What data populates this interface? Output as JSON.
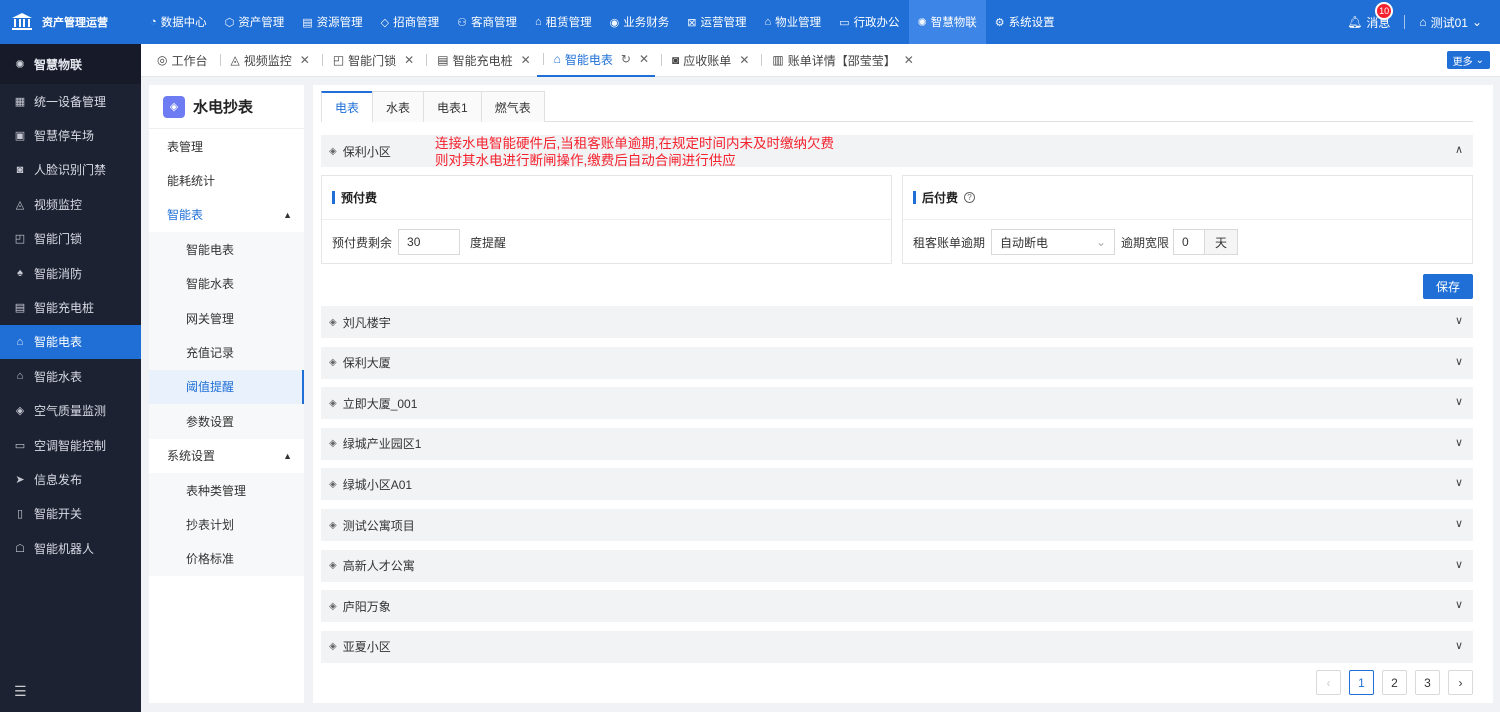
{
  "app": {
    "brand": "资产管理运营"
  },
  "topnav": [
    {
      "icon": "◔",
      "label": "数据中心"
    },
    {
      "icon": "⬡",
      "label": "资产管理"
    },
    {
      "icon": "▤",
      "label": "资源管理"
    },
    {
      "icon": "◇",
      "label": "招商管理"
    },
    {
      "icon": "⚇",
      "label": "客商管理"
    },
    {
      "icon": "⌂",
      "label": "租赁管理"
    },
    {
      "icon": "◉",
      "label": "业务财务"
    },
    {
      "icon": "⊠",
      "label": "运营管理"
    },
    {
      "icon": "⌂",
      "label": "物业管理"
    },
    {
      "icon": "▭",
      "label": "行政办公"
    },
    {
      "icon": "✺",
      "label": "智慧物联"
    },
    {
      "icon": "⚙",
      "label": "系统设置"
    }
  ],
  "top_right": {
    "messages_label": "消息",
    "messages_count": "10",
    "user_label": "测试01"
  },
  "sidebar": {
    "header": "智慧物联",
    "items": [
      {
        "icon": "▦",
        "label": "统一设备管理"
      },
      {
        "icon": "▣",
        "label": "智慧停车场"
      },
      {
        "icon": "◙",
        "label": "人脸识别门禁"
      },
      {
        "icon": "◬",
        "label": "视频监控"
      },
      {
        "icon": "◰",
        "label": "智能门锁"
      },
      {
        "icon": "♠",
        "label": "智能消防"
      },
      {
        "icon": "▤",
        "label": "智能充电桩"
      },
      {
        "icon": "⌂",
        "label": "智能电表"
      },
      {
        "icon": "⌂",
        "label": "智能水表"
      },
      {
        "icon": "◈",
        "label": "空气质量监测"
      },
      {
        "icon": "▭",
        "label": "空调智能控制"
      },
      {
        "icon": "➤",
        "label": "信息发布"
      },
      {
        "icon": "▯",
        "label": "智能开关"
      },
      {
        "icon": "☖",
        "label": "智能机器人"
      }
    ],
    "bottom_icon": "☰"
  },
  "tabs": [
    {
      "icon": "◎",
      "label": "工作台"
    },
    {
      "icon": "◬",
      "label": "视频监控"
    },
    {
      "icon": "◰",
      "label": "智能门锁"
    },
    {
      "icon": "▤",
      "label": "智能充电桩"
    },
    {
      "icon": "⌂",
      "label": "智能电表"
    },
    {
      "icon": "◙",
      "label": "应收账单"
    },
    {
      "icon": "▥",
      "label": "账单详情【邵莹莹】"
    }
  ],
  "more_label": "更多",
  "submenu": {
    "title": "水电抄表",
    "items": [
      {
        "label": "表管理"
      },
      {
        "label": "能耗统计"
      },
      {
        "label": "智能表"
      },
      {
        "label": "智能电表"
      },
      {
        "label": "智能水表"
      },
      {
        "label": "网关管理"
      },
      {
        "label": "充值记录"
      },
      {
        "label": "阈值提醒"
      },
      {
        "label": "参数设置"
      },
      {
        "label": "系统设置"
      },
      {
        "label": "表种类管理"
      },
      {
        "label": "抄表计划"
      },
      {
        "label": "价格标准"
      }
    ]
  },
  "inner_tabs": [
    "电表",
    "水表",
    "电表1",
    "燃气表"
  ],
  "note": {
    "line1": "连接水电智能硬件后,当租客账单逾期,在规定时间内未及时缴纳欠费",
    "line2": "则对其水电进行断闸操作,缴费后自动合闸进行供应"
  },
  "expanded_project": "保利小区",
  "prepaid": {
    "title": "预付费",
    "label": "预付费剩余",
    "value": "30",
    "suffix": "度提醒"
  },
  "postpaid": {
    "title": "后付费",
    "overdue_label": "租客账单逾期",
    "overdue_action": "自动断电",
    "grace_label": "逾期宽限",
    "grace_value": "0",
    "grace_unit": "天"
  },
  "save_label": "保存",
  "projects": [
    "刘凡楼宇",
    "保利大厦",
    "立即大厦_001",
    "绿城产业园区1",
    "绿城小区A01",
    "测试公寓项目",
    "高新人才公寓",
    "庐阳万象",
    "亚夏小区"
  ],
  "pagination": {
    "pages": [
      "1",
      "2",
      "3"
    ],
    "current": 1,
    "prev": "‹",
    "next": "›"
  }
}
